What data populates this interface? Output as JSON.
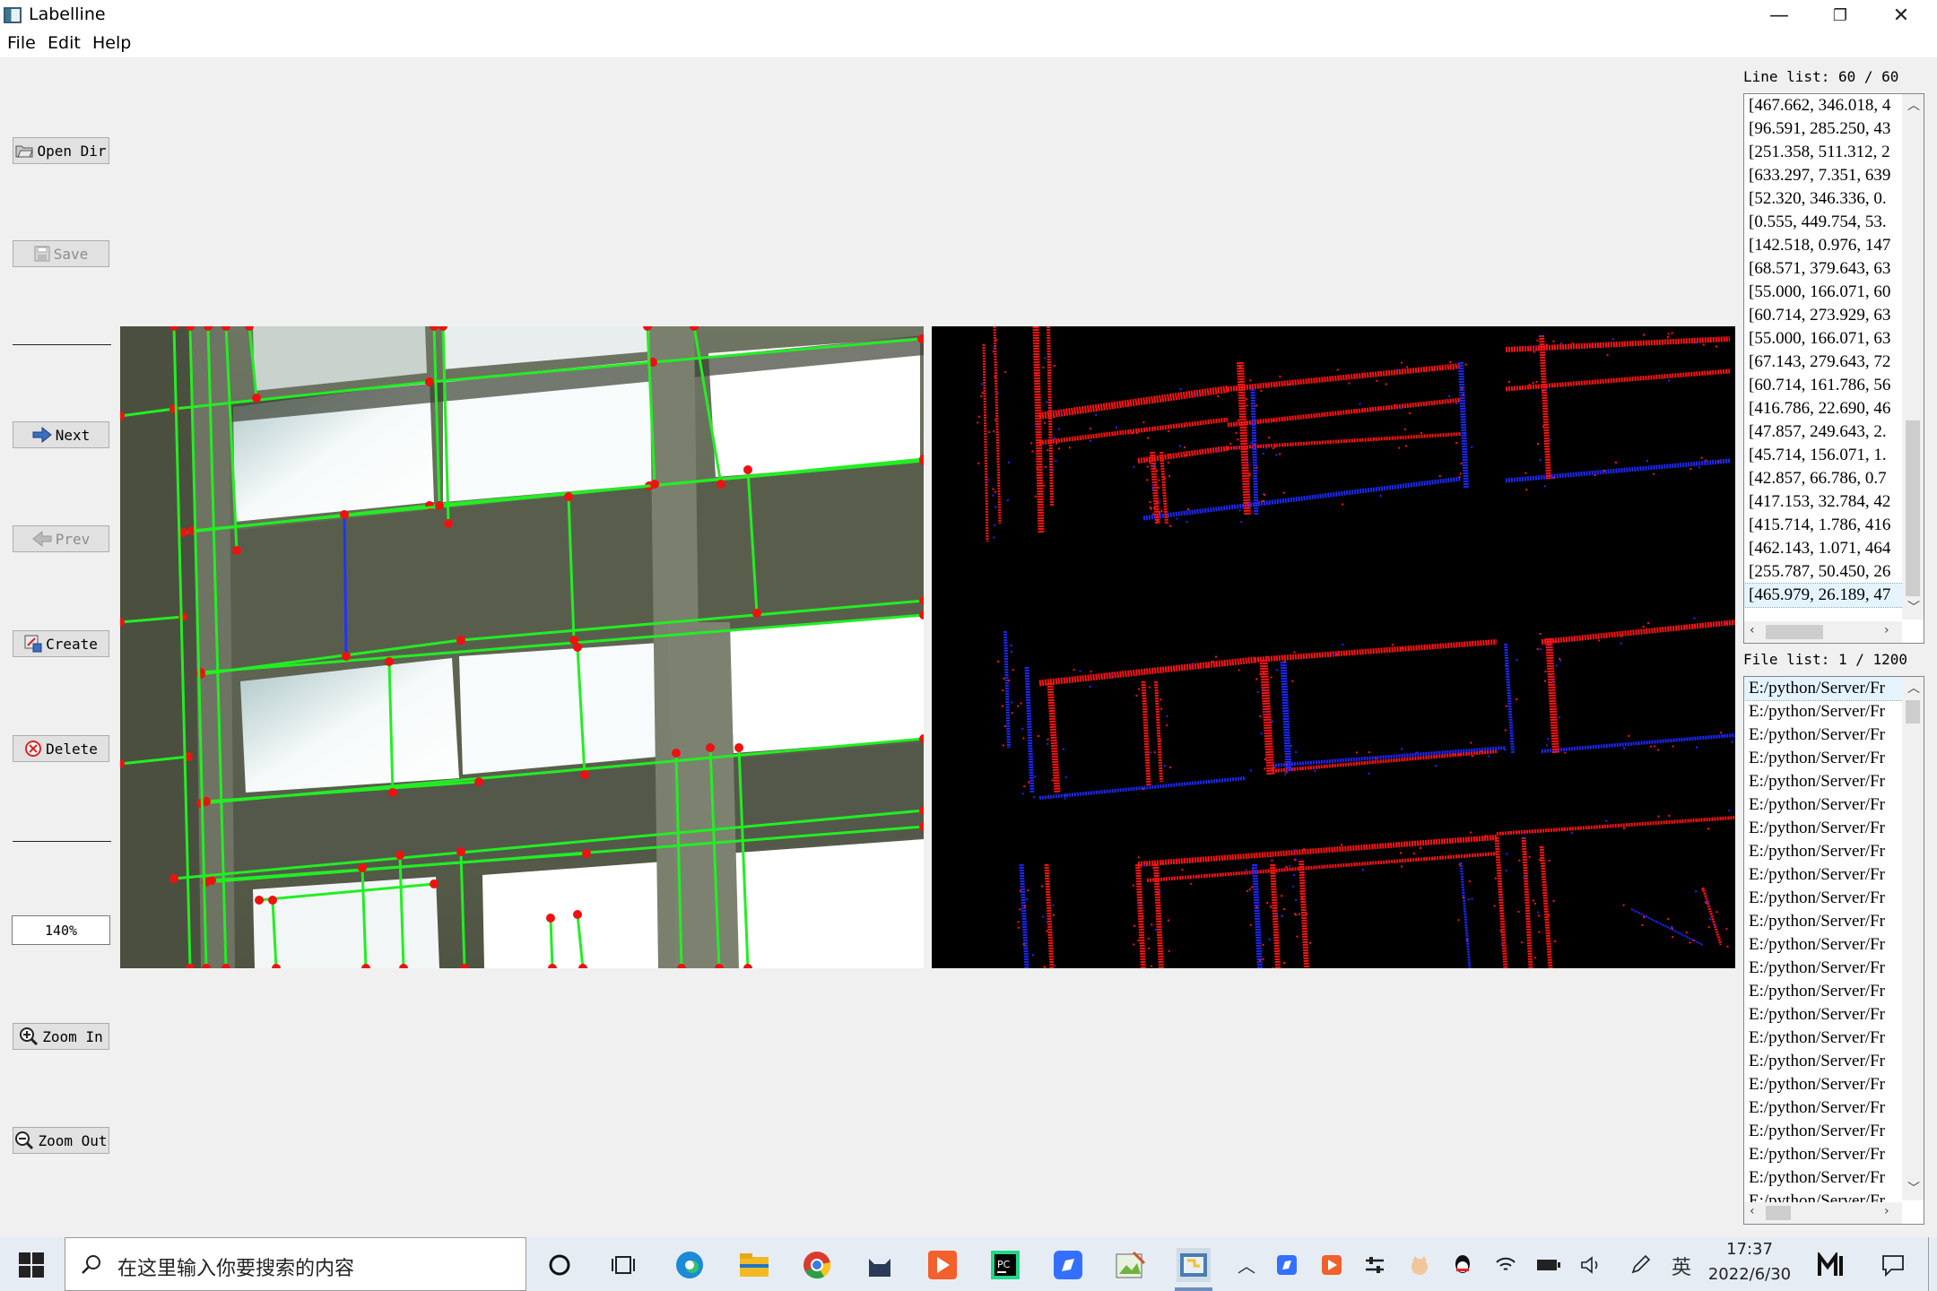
{
  "window": {
    "title": "Labelline",
    "controls": {
      "minimize": "—",
      "maximize": "❐",
      "close": "✕"
    }
  },
  "menu": [
    "File",
    "Edit",
    "Help"
  ],
  "toolbar": {
    "open_dir": "Open Dir",
    "save": "Save",
    "next": "Next",
    "prev": "Prev",
    "create": "Create",
    "delete": "Delete",
    "zoom_value": "140%",
    "zoom_in": "Zoom In",
    "zoom_out": "Zoom Out"
  },
  "line_list": {
    "caption": "Line list: 60 / 60",
    "items": [
      "[467.662, 346.018, 4",
      "[96.591, 285.250, 43",
      "[251.358, 511.312, 2",
      "[633.297, 7.351, 639",
      "[52.320, 346.336, 0.",
      "[0.555, 449.754, 53.",
      "[142.518, 0.976, 147",
      "[68.571, 379.643, 63",
      "[55.000, 166.071, 60",
      "[60.714, 273.929, 63",
      "[55.000, 166.071, 63",
      "[67.143, 279.643, 72",
      "[60.714, 161.786, 56",
      "[416.786, 22.690, 46",
      "[47.857, 249.643, 2.",
      "[45.714, 156.071, 1.",
      "[42.857, 66.786, 0.7",
      "[417.153, 32.784, 42",
      "[415.714, 1.786, 416",
      "[462.143, 1.071, 464",
      "[255.787, 50.450, 26",
      "[465.979, 26.189, 47"
    ],
    "selected_index": 21
  },
  "file_list": {
    "caption": "File list: 1 / 1200",
    "items": [
      "E:/python/Server/Fr",
      "E:/python/Server/Fr",
      "E:/python/Server/Fr",
      "E:/python/Server/Fr",
      "E:/python/Server/Fr",
      "E:/python/Server/Fr",
      "E:/python/Server/Fr",
      "E:/python/Server/Fr",
      "E:/python/Server/Fr",
      "E:/python/Server/Fr",
      "E:/python/Server/Fr",
      "E:/python/Server/Fr",
      "E:/python/Server/Fr",
      "E:/python/Server/Fr",
      "E:/python/Server/Fr",
      "E:/python/Server/Fr",
      "E:/python/Server/Fr",
      "E:/python/Server/Fr",
      "E:/python/Server/Fr",
      "E:/python/Server/Fr",
      "E:/python/Server/Fr",
      "E:/python/Server/Fr",
      "E:/python/Server/Fr"
    ],
    "selected_index": 0
  },
  "taskbar": {
    "search_placeholder": "在这里输入你要搜索的内容",
    "ime": "英",
    "time": "17:37",
    "date": "2022/6/30"
  },
  "colors": {
    "line_green": "#22ee22",
    "point_red": "#ee1111",
    "event_red": "#ff1414",
    "event_blue": "#1e28ff"
  },
  "icons": [
    "app-icon",
    "folder-icon",
    "save-icon",
    "arrow-right-icon",
    "arrow-left-icon",
    "create-icon",
    "delete-icon",
    "zoom-in-icon",
    "zoom-out-icon",
    "windows-start-icon",
    "search-icon"
  ]
}
